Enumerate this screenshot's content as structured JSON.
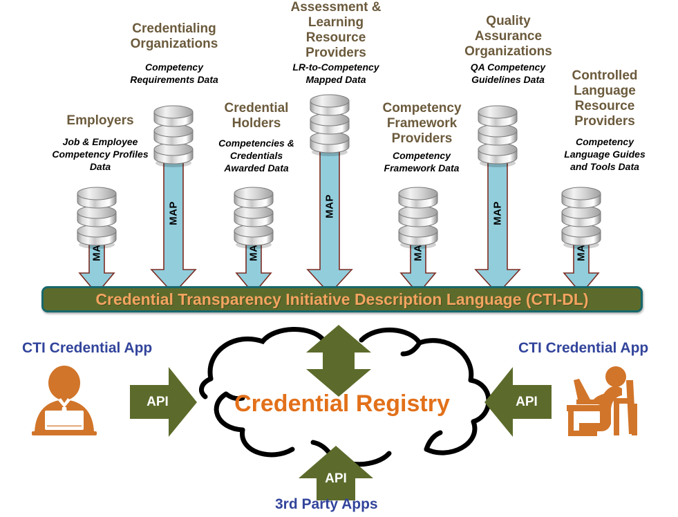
{
  "colors": {
    "provider_title": "#6b5a3c",
    "map_arrow_fill": "#92cddc",
    "map_arrow_stroke": "#7b2b20",
    "ctidl_bar_fill": "#5c6b2b",
    "ctidl_bar_border": "#17676b",
    "ctidl_text": "#f4a460",
    "registry_text": "#e2701a",
    "app_label_text": "#32449b",
    "api_arrow_fill": "#5c6b2b",
    "api_label_text": "#ffffff",
    "persona_fill": "#d1752a",
    "cloud_stroke": "#000000",
    "background": "#ffffff"
  },
  "providers": [
    {
      "id": "employers",
      "title": "Employers",
      "subtitle": "Job & Employee\nCompetency Profiles\nData",
      "map_label": "MAP"
    },
    {
      "id": "credentialing-organizations",
      "title": "Credentialing\nOrganizations",
      "subtitle": "Competency\nRequirements Data",
      "map_label": "MAP"
    },
    {
      "id": "credential-holders",
      "title": "Credential\nHolders",
      "subtitle": "Competencies &\nCredentials\nAwarded Data",
      "map_label": "MAP"
    },
    {
      "id": "assessment-learning-resource-providers",
      "title": "Assessment &\nLearning\nResource\nProviders",
      "subtitle": "LR-to-Competency\nMapped Data",
      "map_label": "MAP"
    },
    {
      "id": "competency-framework-providers",
      "title": "Competency\nFramework\nProviders",
      "subtitle": "Competency\nFramework Data",
      "map_label": "MAP"
    },
    {
      "id": "quality-assurance-organizations",
      "title": "Quality\nAssurance\nOrganizations",
      "subtitle": "QA Competency\nGuidelines Data",
      "map_label": "MAP"
    },
    {
      "id": "controlled-language-resource-providers",
      "title": "Controlled\nLanguage\nResource\nProviders",
      "subtitle": "Competency\nLanguage Guides\nand Tools Data",
      "map_label": "MAP"
    }
  ],
  "ctidl": {
    "label": "Credential Transparency Initiative Description Language (CTI-DL)"
  },
  "registry": {
    "label": "Credential Registry"
  },
  "bottom": {
    "left_app_label": "CTI Credential App",
    "right_app_label": "CTI Credential App",
    "bottom_app_label": "3rd Party Apps",
    "api_left_label": "API",
    "api_right_label": "API",
    "api_bottom_label": "API"
  }
}
